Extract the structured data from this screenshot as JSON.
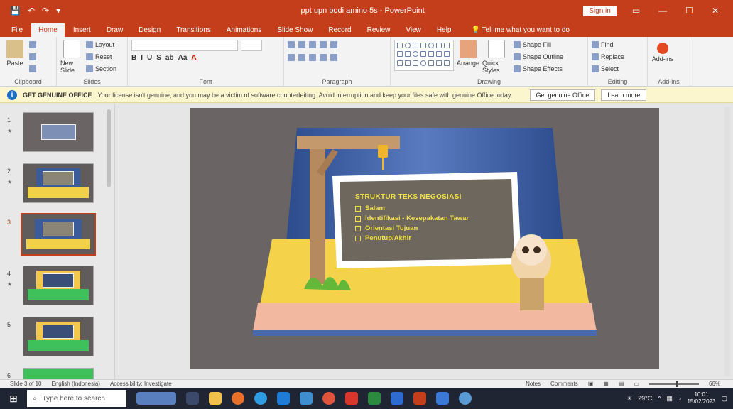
{
  "titlebar": {
    "qat": [
      "💾",
      "↶",
      "↷",
      "▾"
    ],
    "title": "ppt upn bodi amino 5s - PowerPoint",
    "signin": "Sign in",
    "controls": [
      "▭",
      "—",
      "☐",
      "✕"
    ]
  },
  "ribbon": {
    "tabs": [
      "File",
      "Home",
      "Insert",
      "Draw",
      "Design",
      "Transitions",
      "Animations",
      "Slide Show",
      "Record",
      "Review",
      "View",
      "Help"
    ],
    "tell_me": "Tell me what you want to do",
    "groups": {
      "clipboard": {
        "label": "Clipboard",
        "paste": "Paste"
      },
      "slides": {
        "label": "Slides",
        "new_slide": "New Slide",
        "layout": "Layout",
        "reset": "Reset",
        "section": "Section"
      },
      "font": {
        "label": "Font",
        "format_buttons": [
          "B",
          "I",
          "U",
          "S",
          "ab",
          "Aa",
          "A"
        ]
      },
      "paragraph": {
        "label": "Paragraph"
      },
      "drawing": {
        "label": "Drawing",
        "arrange": "Arrange",
        "quick_styles": "Quick Styles",
        "shape_fill": "Shape Fill",
        "shape_outline": "Shape Outline",
        "shape_effects": "Shape Effects"
      },
      "editing": {
        "label": "Editing",
        "find": "Find",
        "replace": "Replace",
        "select": "Select"
      },
      "addins": {
        "label": "Add-ins",
        "button": "Add-ins"
      }
    }
  },
  "message_bar": {
    "title": "GET GENUINE OFFICE",
    "text": "Your license isn't genuine, and you may be a victim of software counterfeiting. Avoid interruption and keep your files safe with genuine Office today.",
    "buttons": [
      "Get genuine Office",
      "Learn more"
    ]
  },
  "slides": [
    {
      "number": "1",
      "star": "★"
    },
    {
      "number": "2",
      "star": "★"
    },
    {
      "number": "3",
      "star": ""
    },
    {
      "number": "4",
      "star": "★"
    },
    {
      "number": "5",
      "star": ""
    },
    {
      "number": "6",
      "star": ""
    }
  ],
  "selected_slide_index": 2,
  "current_slide": {
    "board_title": "STRUKTUR TEKS NEGOSIASI",
    "items": [
      "Salam",
      "Identifikasi - Kesepakatan Tawar",
      "Orientasi Tujuan",
      "Penutup/Akhir"
    ]
  },
  "status": {
    "slide_info": "Slide 3 of 10",
    "language": "English (Indonesia)",
    "accessibility": "Accessibility: Investigate",
    "notes": "Notes",
    "comments": "Comments",
    "zoom": "66%"
  },
  "taskbar": {
    "search_placeholder": "Type here to search",
    "weather": "29°C",
    "time": "10:01",
    "date": "15/02/2023"
  },
  "colors": {
    "accent": "#c43e1c",
    "board_text": "#f2e14a"
  }
}
